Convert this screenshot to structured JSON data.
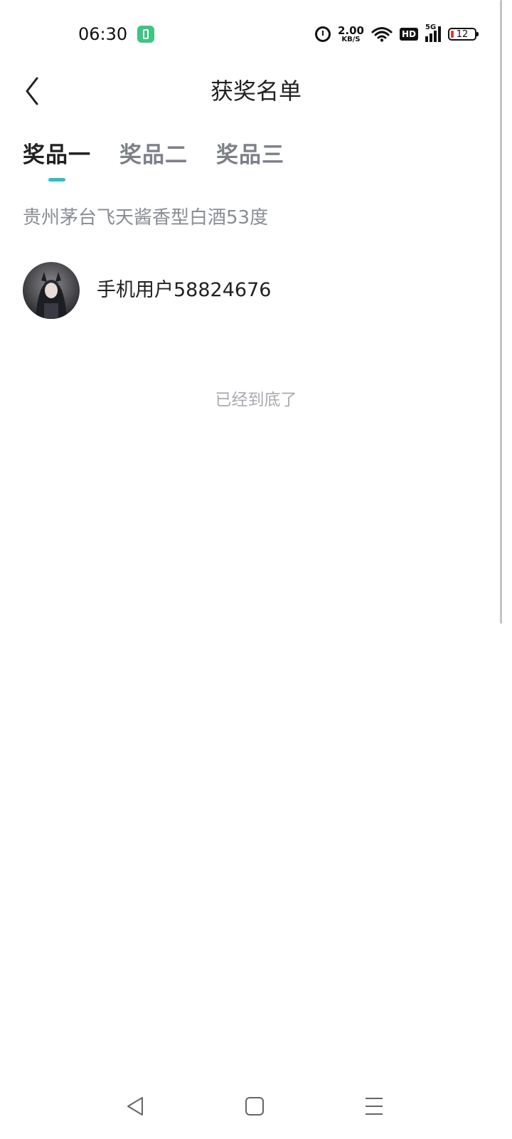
{
  "status_bar": {
    "time": "06:30",
    "net_speed_value": "2.00",
    "net_speed_unit": "KB/S",
    "hd_label": "HD",
    "signal_label": "5G",
    "battery_level": "12",
    "icons": [
      "battery-saver-icon",
      "alarm-icon",
      "wifi-icon",
      "hd-icon",
      "signal-icon",
      "battery-icon"
    ]
  },
  "header": {
    "title": "获奖名单",
    "back_icon": "chevron-left-icon"
  },
  "tabs": [
    {
      "label": "奖品一",
      "active": true
    },
    {
      "label": "奖品二",
      "active": false
    },
    {
      "label": "奖品三",
      "active": false
    }
  ],
  "prize": {
    "name": "贵州茅台飞天酱香型白酒53度"
  },
  "winners": [
    {
      "name": "手机用户58824676"
    }
  ],
  "list_end_text": "已经到底了",
  "colors": {
    "accent": "#2bc0c8",
    "text_primary": "#222222",
    "text_secondary": "#8a8d94",
    "text_muted": "#a8abb0",
    "battery_low": "#e53935"
  },
  "bottom_nav": {
    "icons": [
      "back-triangle-icon",
      "home-square-icon",
      "menu-lines-icon"
    ]
  }
}
